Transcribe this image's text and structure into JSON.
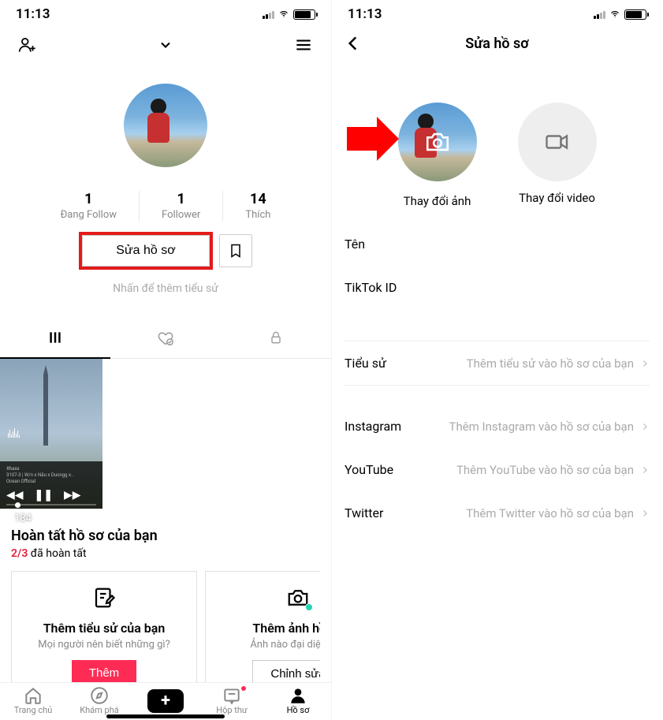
{
  "status_bar": {
    "time": "11:13"
  },
  "left": {
    "stats": {
      "following": {
        "count": "1",
        "label": "Đang Follow"
      },
      "followers": {
        "count": "1",
        "label": "Follower"
      },
      "likes": {
        "count": "14",
        "label": "Thích"
      }
    },
    "edit_button": "Sửa hồ sơ",
    "bio_hint": "Nhấn để thêm tiểu sử",
    "video_views": "184",
    "complete": {
      "title": "Hoàn tất hồ sơ của bạn",
      "done": "2/3",
      "done_suffix": " đã hoàn tất"
    },
    "cards": {
      "bio": {
        "title": "Thêm tiểu sử của bạn",
        "sub": "Mọi người nên biết những gì?",
        "btn": "Thêm"
      },
      "photo": {
        "title": "Thêm ảnh hồ sơ",
        "sub": "Ảnh nào đại diện cho",
        "btn": "Chỉnh sửa"
      }
    },
    "nav": {
      "home": "Trang chủ",
      "discover": "Khám phá",
      "inbox": "Hộp thư",
      "profile": "Hồ sơ"
    }
  },
  "right": {
    "title": "Sửa hồ sơ",
    "change_photo": "Thay đổi ảnh",
    "change_video": "Thay đổi video",
    "rows": {
      "name": "Tên",
      "id": "TikTok ID",
      "bio": {
        "label": "Tiểu sử",
        "value": "Thêm tiểu sử vào hồ sơ của bạn"
      },
      "instagram": {
        "label": "Instagram",
        "value": "Thêm Instagram vào hồ sơ của bạn"
      },
      "youtube": {
        "label": "YouTube",
        "value": "Thêm YouTube vào hồ sơ của bạn"
      },
      "twitter": {
        "label": "Twitter",
        "value": "Thêm Twitter vào hồ sơ của bạn"
      }
    }
  }
}
